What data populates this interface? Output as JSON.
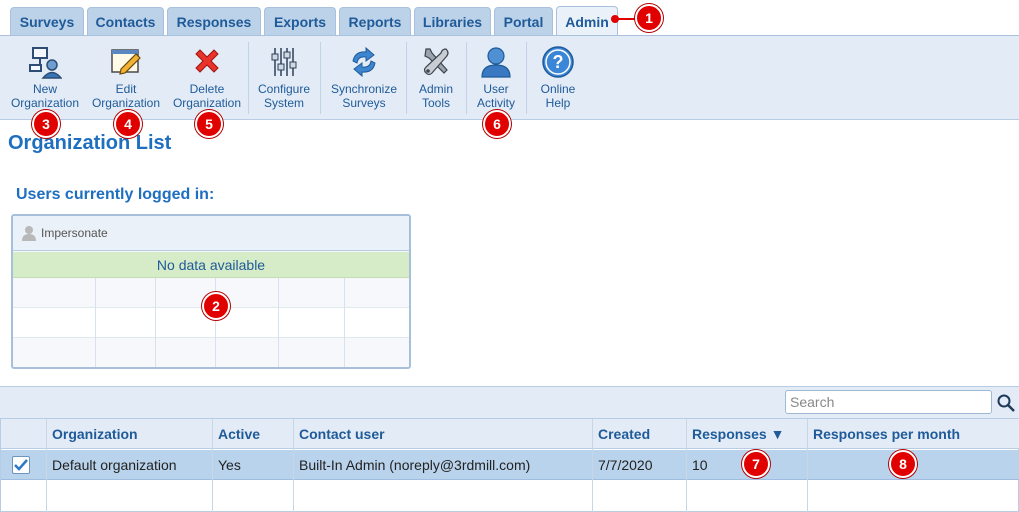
{
  "tabs": [
    {
      "label": "Surveys",
      "active": false
    },
    {
      "label": "Contacts",
      "active": false
    },
    {
      "label": "Responses",
      "active": false
    },
    {
      "label": "Exports",
      "active": false
    },
    {
      "label": "Reports",
      "active": false
    },
    {
      "label": "Libraries",
      "active": false
    },
    {
      "label": "Portal",
      "active": false
    },
    {
      "label": "Admin",
      "active": true
    }
  ],
  "toolbar": {
    "new_org": "New\nOrganization",
    "edit_org": "Edit\nOrganization",
    "delete_org": "Delete\nOrganization",
    "configure": "Configure\nSystem",
    "sync": "Synchronize\nSurveys",
    "admin_tools": "Admin\nTools",
    "user_activity": "User\nActivity",
    "online_help": "Online\nHelp"
  },
  "page_title": "Organization List",
  "users_section": {
    "title": "Users currently logged in:",
    "impersonate_label": "Impersonate",
    "no_data": "No data available"
  },
  "search": {
    "placeholder": "Search",
    "value": ""
  },
  "table": {
    "columns": [
      "Organization",
      "Active",
      "Contact user",
      "Created",
      "Responses ▼",
      "Responses per month"
    ],
    "rows": [
      {
        "selected": true,
        "organization": "Default organization",
        "active": "Yes",
        "contact_user": "Built-In Admin (noreply@3rdmill.com)",
        "created": "7/7/2020",
        "responses": "10",
        "responses_per_month": ""
      }
    ]
  },
  "badges": [
    "1",
    "2",
    "3",
    "4",
    "5",
    "6",
    "7",
    "8"
  ],
  "colors": {
    "accent": "#1f6fc1",
    "tab_bg": "#bcd2e8",
    "toolbar_bg": "#e3ecf6",
    "selected_row": "#b9d3ec",
    "no_data_bg": "#d6ecc8",
    "badge": "#e00000"
  }
}
